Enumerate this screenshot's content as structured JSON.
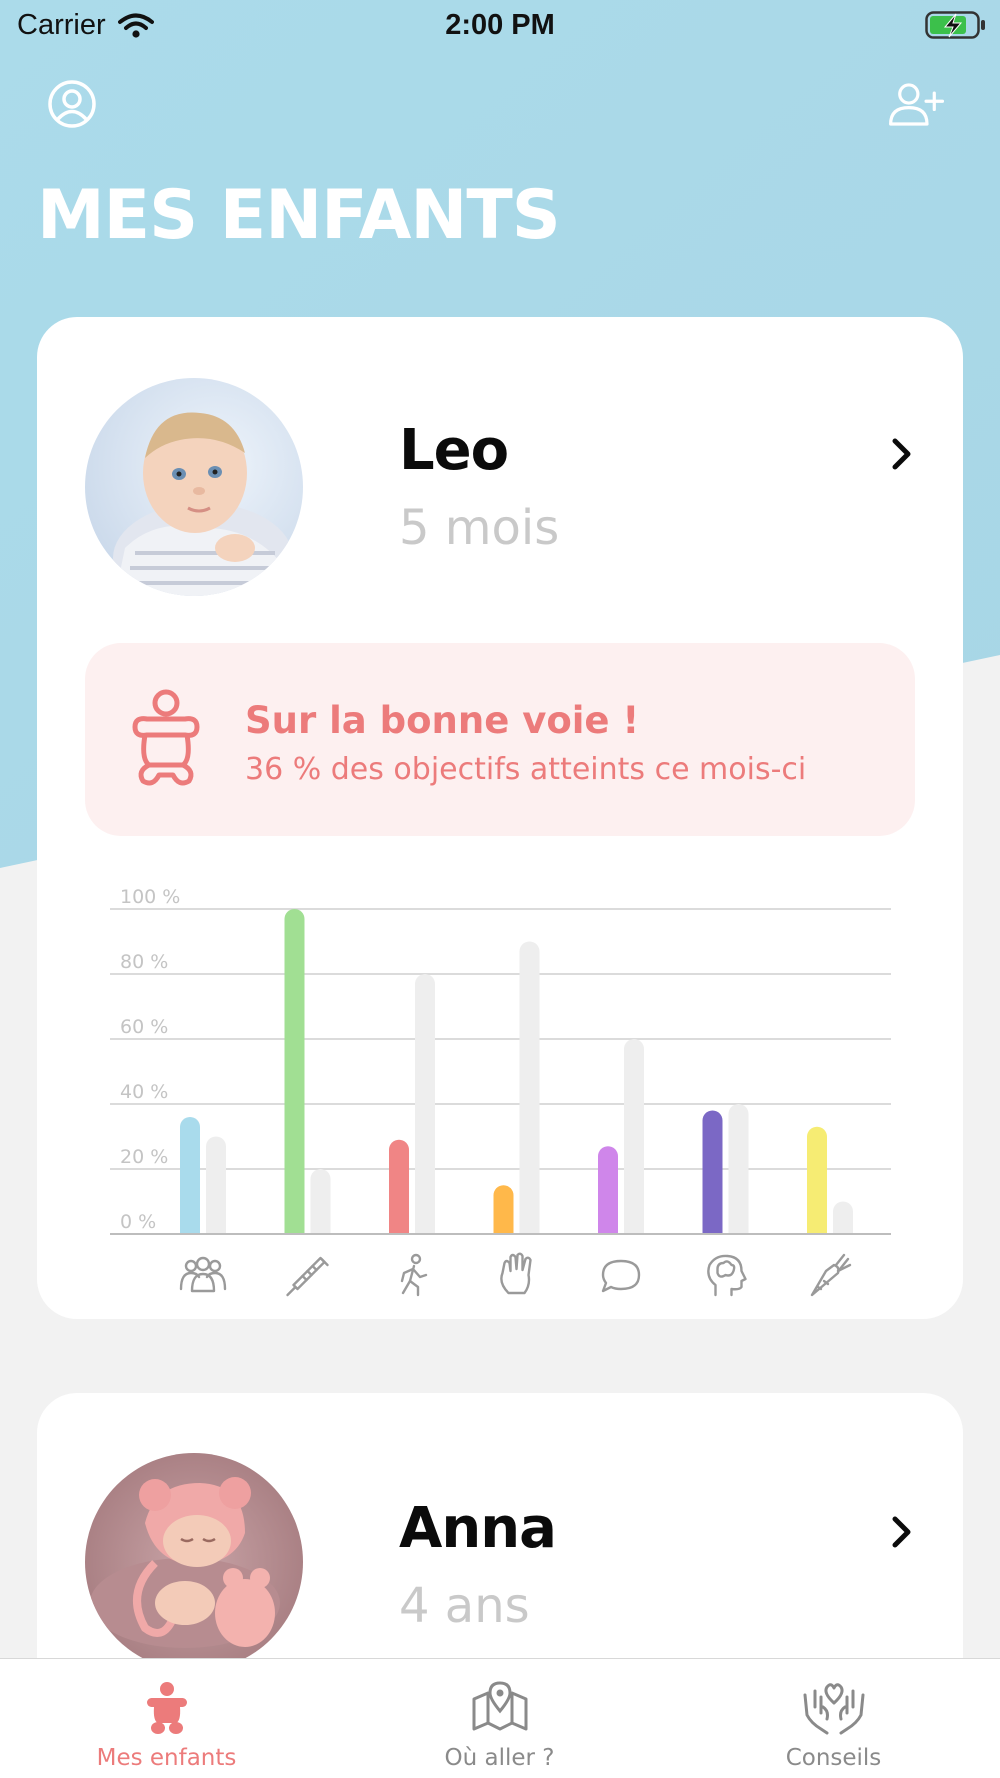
{
  "status_bar": {
    "carrier": "Carrier",
    "time": "2:00 PM"
  },
  "header": {
    "title": "MES ENFANTS",
    "profile_icon": "user-circle-icon",
    "add_icon": "user-plus-icon"
  },
  "colors": {
    "hero": "#acdbe9",
    "accent": "#ec7b7b",
    "banner_bg": "#fdf0f0",
    "card_bg": "#ffffff",
    "page_bg": "#f2f2f2"
  },
  "children": [
    {
      "name": "Leo",
      "age": "5 mois",
      "progress": {
        "title": "Sur la bonne voie !",
        "subtitle": "36 % des objectifs atteints ce mois-ci"
      }
    },
    {
      "name": "Anna",
      "age": "4 ans"
    }
  ],
  "chart_data": {
    "type": "bar",
    "ylim": [
      0,
      100
    ],
    "yticks": [
      "0 %",
      "20 %",
      "40 %",
      "60 %",
      "80 %",
      "100 %"
    ],
    "ytick_values": [
      0,
      20,
      40,
      60,
      80,
      100
    ],
    "categories": [
      {
        "icon": "family-icon",
        "color": "#a9dbec"
      },
      {
        "icon": "syringe-icon",
        "color": "#a1df93"
      },
      {
        "icon": "walking-icon",
        "color": "#f08585"
      },
      {
        "icon": "hand-icon",
        "color": "#ffb84a"
      },
      {
        "icon": "speech-bubble-icon",
        "color": "#cf86ea"
      },
      {
        "icon": "brain-head-icon",
        "color": "#7b68c5"
      },
      {
        "icon": "carrot-icon",
        "color": "#f6ec73"
      }
    ],
    "series": [
      {
        "values": [
          36,
          100,
          29,
          15,
          27,
          38,
          33
        ]
      },
      {
        "values": [
          30,
          20,
          80,
          90,
          60,
          40,
          10
        ],
        "color": "#eeeeee"
      }
    ],
    "grid": true
  },
  "tabs": [
    {
      "label": "Mes enfants",
      "icon": "baby-icon",
      "active": true
    },
    {
      "label": "Où aller ?",
      "icon": "map-pin-icon",
      "active": false
    },
    {
      "label": "Conseils",
      "icon": "hands-heart-icon",
      "active": false
    }
  ]
}
